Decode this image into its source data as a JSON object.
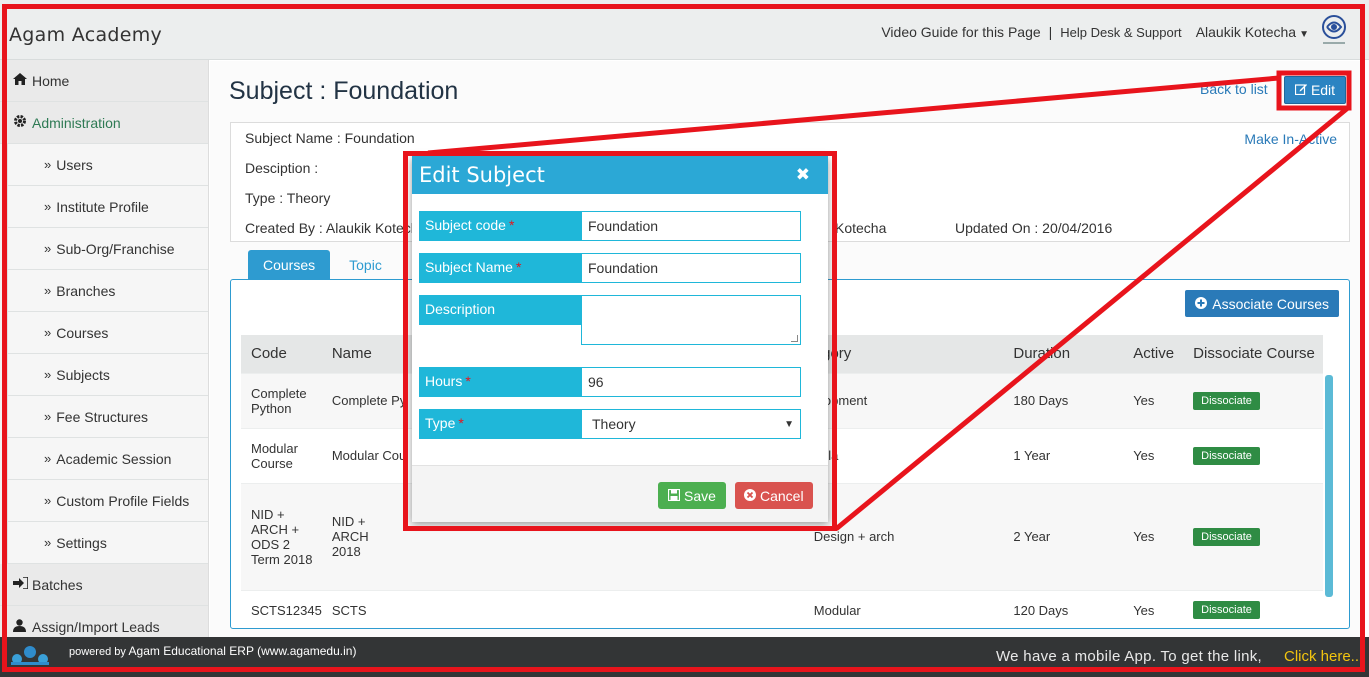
{
  "app": {
    "brand": "Agam Academy",
    "video_guide": "Video Guide for this Page",
    "separator": "|",
    "help_desk": "Help Desk & Support",
    "user_name": "Alaukik Kotecha"
  },
  "sidebar": {
    "items": [
      {
        "label": "Home",
        "icon": "home-icon",
        "level": "top"
      },
      {
        "label": "Administration",
        "icon": "gear-icon",
        "level": "top",
        "active": true
      },
      {
        "label": "Users",
        "level": "sub"
      },
      {
        "label": "Institute Profile",
        "level": "sub"
      },
      {
        "label": "Sub-Org/Franchise",
        "level": "sub"
      },
      {
        "label": "Branches",
        "level": "sub"
      },
      {
        "label": "Courses",
        "level": "sub"
      },
      {
        "label": "Subjects",
        "level": "sub"
      },
      {
        "label": "Fee Structures",
        "level": "sub"
      },
      {
        "label": "Academic Session",
        "level": "sub"
      },
      {
        "label": "Custom Profile Fields",
        "level": "sub"
      },
      {
        "label": "Settings",
        "level": "sub"
      },
      {
        "label": "Batches",
        "icon": "sign-in-icon",
        "level": "top"
      },
      {
        "label": "Assign/Import Leads",
        "icon": "user-icon",
        "level": "top"
      }
    ]
  },
  "page": {
    "title": "Subject : Foundation",
    "back_to_list": "Back to list",
    "edit_label": "Edit",
    "make_inactive": "Make In-Active",
    "info": {
      "subject_name": "Subject Name : Foundation",
      "description": "Desciption :",
      "type": "Type : Theory",
      "created_by": "Created By : Alaukik Kotecha",
      "updated_by_tail": "Kotecha",
      "updated_on": "Updated On : 20/04/2016"
    },
    "tabs": [
      {
        "label": "Courses",
        "active": true
      },
      {
        "label": "Topic",
        "active": false
      }
    ],
    "associate_courses": "Associate Courses"
  },
  "table": {
    "headers": [
      "Code",
      "Name",
      "Category",
      "Duration",
      "Active",
      "Dissociate Course"
    ],
    "headers_visible": [
      "Code",
      "Name",
      "egory",
      "Duration",
      "Active",
      "Dissociate Course"
    ],
    "rows": [
      {
        "code": "Complete Python",
        "name": "Complete Py",
        "category": "elopment",
        "duration": "180 Days",
        "active": "Yes",
        "action": "Dissociate"
      },
      {
        "code": "Modular Course",
        "name": "Modular Cou",
        "category": "dula",
        "duration": "1 Year",
        "active": "Yes",
        "action": "Dissociate"
      },
      {
        "code": "NID + ARCH + ODS 2 Term 2018",
        "name": "NID + ARCH 2018",
        "category": "Design + arch",
        "duration": "2 Year",
        "active": "Yes",
        "action": "Dissociate"
      },
      {
        "code": "SCTS12345",
        "name": "SCTS",
        "category": "Modular",
        "duration": "120 Days",
        "active": "Yes",
        "action": "Dissociate"
      }
    ]
  },
  "modal": {
    "title": "Edit Subject",
    "fields": {
      "subject_code_label": "Subject code",
      "subject_code_value": "Foundation",
      "subject_name_label": "Subject Name",
      "subject_name_value": "Foundation",
      "description_label": "Description",
      "description_value": "",
      "hours_label": "Hours",
      "hours_value": "96",
      "type_label": "Type",
      "type_value": "Theory"
    },
    "required_mark": "*",
    "save_label": "Save",
    "cancel_label": "Cancel"
  },
  "footer": {
    "powered_prefix": "powered by",
    "powered_text": "Agam Educational ERP (www.agamedu.in)",
    "mobile_msg": "We have a mobile App. To get the link,",
    "click_here": "Click here.."
  },
  "colors": {
    "annotation_red": "#e8141c",
    "primary_blue": "#2b84c2",
    "modal_header": "#2ba8d6",
    "label_cyan": "#1fb7d9",
    "save_green": "#4caf50",
    "cancel_red": "#d9534f",
    "footer_bg": "#333536",
    "click_here": "#f1c40f"
  }
}
